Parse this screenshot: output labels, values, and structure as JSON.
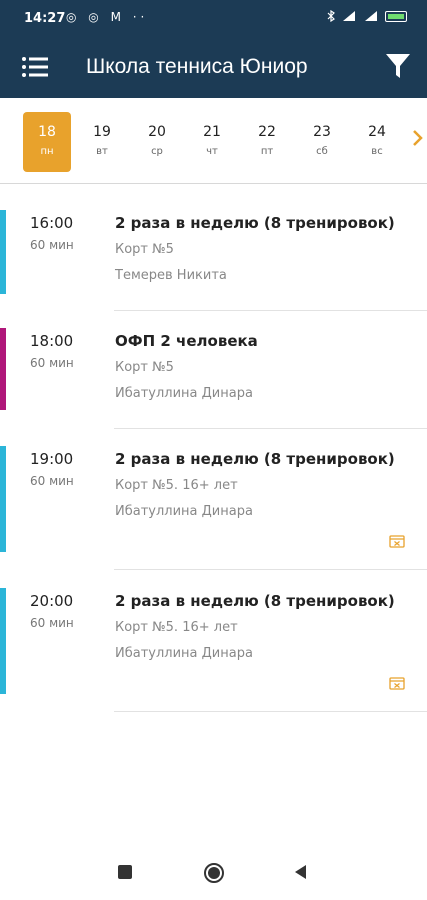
{
  "status_bar": {
    "time": "14:27",
    "left_icons": "◎ ◎ M ··"
  },
  "app_bar": {
    "title": "Школа тенниса Юниор",
    "menu_icon": "menu-icon",
    "filter_icon": "filter-icon"
  },
  "accent_color": "#e8a22c",
  "dates": [
    {
      "num": "18",
      "day": "пн",
      "selected": true
    },
    {
      "num": "19",
      "day": "вт",
      "selected": false
    },
    {
      "num": "20",
      "day": "ср",
      "selected": false
    },
    {
      "num": "21",
      "day": "чт",
      "selected": false
    },
    {
      "num": "22",
      "day": "пт",
      "selected": false
    },
    {
      "num": "23",
      "day": "сб",
      "selected": false
    },
    {
      "num": "24",
      "day": "вс",
      "selected": false
    }
  ],
  "lessons": [
    {
      "time": "16:00",
      "duration": "60 мин",
      "title": "2 раза в неделю (8 тренировок)",
      "court": "Корт №5",
      "coach": "Темерев Никита",
      "color": "#2bb5d8",
      "has_receipt": false
    },
    {
      "time": "18:00",
      "duration": "60 мин",
      "title": "ОФП 2 человека",
      "court": "Корт №5",
      "coach": "Ибатуллина Динара",
      "color": "#b0177a",
      "has_receipt": false
    },
    {
      "time": "19:00",
      "duration": "60 мин",
      "title": "2 раза в неделю (8 тренировок)",
      "court": "Корт №5. 16+ лет",
      "coach": "Ибатуллина Динара",
      "color": "#2bb5d8",
      "has_receipt": true
    },
    {
      "time": "20:00",
      "duration": "60 мин",
      "title": "2 раза в неделю (8 тренировок)",
      "court": "Корт №5. 16+ лет",
      "coach": "Ибатуллина Динара",
      "color": "#2bb5d8",
      "has_receipt": true
    }
  ]
}
